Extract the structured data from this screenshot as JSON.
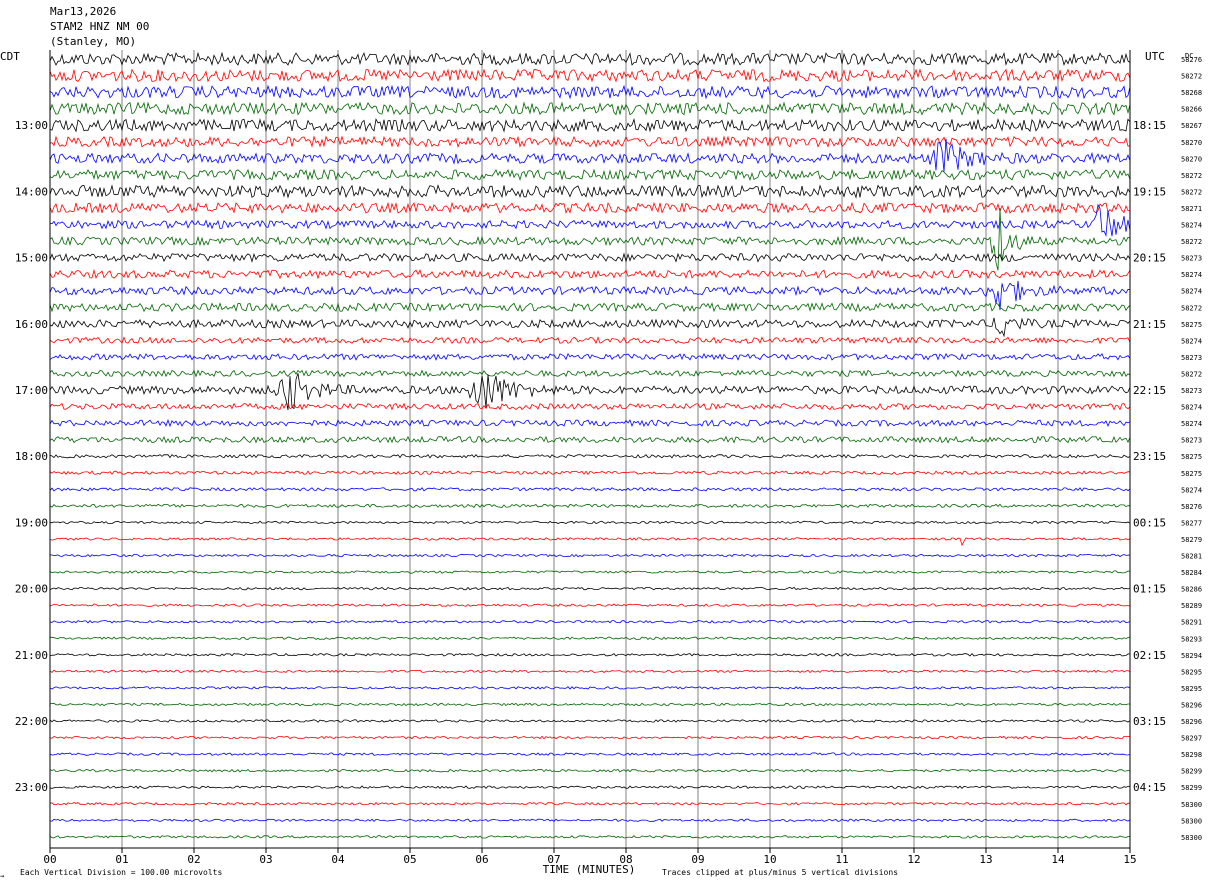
{
  "header": {
    "date": "Mar13,2026",
    "station": "STAM2 HNZ NM 00",
    "location": "(Stanley, MO)"
  },
  "left_zone_label": "CDT",
  "right_zone_label": "UTC",
  "dc_label": "DC",
  "footer": {
    "scale_note": "Each Vertical Division =  100.00 microvolts",
    "clip_note": "Traces clipped at plus/minus 5 vertical divisions",
    "corner_mark": "→"
  },
  "colors": {
    "trace_cycle": [
      "#000000",
      "#ff0000",
      "#0000ff",
      "#006400"
    ],
    "grid": "#808080",
    "axis": "#000000"
  },
  "chart_data": {
    "type": "helicorder",
    "xlabel": "TIME (MINUTES)",
    "x_ticks": [
      "00",
      "01",
      "02",
      "03",
      "04",
      "05",
      "06",
      "07",
      "08",
      "09",
      "10",
      "11",
      "12",
      "13",
      "14",
      "15"
    ],
    "xlim": [
      0,
      15
    ],
    "minutes_per_line": 15,
    "lines_per_hour": 4,
    "left_hour_labels": [
      "13:00",
      "14:00",
      "15:00",
      "16:00",
      "17:00",
      "18:00",
      "19:00",
      "20:00",
      "21:00",
      "22:00",
      "23:00"
    ],
    "right_hour_labels": [
      "18:15",
      "19:15",
      "20:15",
      "21:15",
      "22:15",
      "23:15",
      "00:15",
      "01:15",
      "02:15",
      "03:15",
      "04:15"
    ],
    "first_labeled_line": 4,
    "dc_offsets": [
      58276,
      58272,
      58268,
      58266,
      58267,
      58270,
      58270,
      58272,
      58272,
      58271,
      58274,
      58272,
      58273,
      58274,
      58274,
      58272,
      58275,
      58274,
      58273,
      58272,
      58273,
      58274,
      58274,
      58273,
      58275,
      58275,
      58274,
      58276,
      58277,
      58279,
      58281,
      58284,
      58286,
      58289,
      58291,
      58293,
      58294,
      58295,
      58295,
      58296,
      58296,
      58297,
      58298,
      58299,
      58299,
      58300,
      58300,
      58300
    ],
    "noise_amplitude": [
      6,
      6,
      6,
      6,
      6,
      5,
      5,
      5,
      6,
      5,
      4,
      4,
      4,
      4,
      4,
      4,
      4,
      3,
      3,
      3,
      4,
      3,
      3,
      3,
      1.6,
      1.6,
      1.6,
      1.6,
      1.2,
      1.2,
      1.2,
      1.2,
      1.2,
      1.2,
      1.2,
      1.2,
      1.2,
      1.2,
      1.2,
      1.2,
      1.2,
      1.2,
      1.2,
      1.2,
      1.2,
      1.2,
      1.2,
      1.2
    ],
    "events": [
      {
        "line": 6,
        "minute": 12.4,
        "amplitude": 18,
        "duration_min": 0.4
      },
      {
        "line": 10,
        "minute": 14.6,
        "amplitude": 24,
        "duration_min": 0.3
      },
      {
        "line": 11,
        "minute": 13.15,
        "amplitude": 50,
        "duration_min": 0.2
      },
      {
        "line": 14,
        "minute": 13.15,
        "amplitude": 22,
        "duration_min": 0.35
      },
      {
        "line": 16,
        "minute": 13.2,
        "amplitude": 18,
        "duration_min": 0.2
      },
      {
        "line": 20,
        "minute": 3.3,
        "amplitude": 22,
        "duration_min": 0.4
      },
      {
        "line": 20,
        "minute": 6.0,
        "amplitude": 22,
        "duration_min": 0.5
      },
      {
        "line": 29,
        "minute": 12.65,
        "amplitude": 10,
        "duration_min": 0.05
      }
    ]
  }
}
